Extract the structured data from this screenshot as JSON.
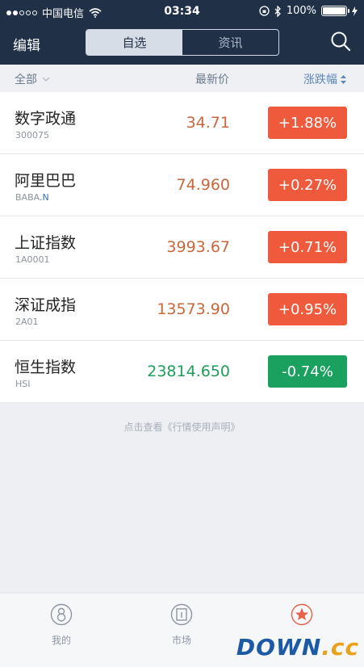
{
  "status": {
    "carrier": "中国电信",
    "time": "03:34",
    "battery": "100%"
  },
  "nav": {
    "edit": "编辑",
    "tabs": [
      {
        "label": "自选",
        "active": true
      },
      {
        "label": "资讯",
        "active": false
      }
    ]
  },
  "header": {
    "all": "全部",
    "price": "最新价",
    "change": "涨跌幅"
  },
  "colors": {
    "up": "#f05a3c",
    "down": "#1aa05f",
    "price_up": "#c8673c",
    "price_down": "#1e9e5a"
  },
  "stocks": [
    {
      "name": "数字政通",
      "code": "300075",
      "tag": "",
      "price": "34.71",
      "change": "+1.88%",
      "direction": "up"
    },
    {
      "name": "阿里巴巴",
      "code": "BABA",
      "tag": ".N",
      "price": "74.960",
      "change": "+0.27%",
      "direction": "up"
    },
    {
      "name": "上证指数",
      "code": "1A0001",
      "tag": "",
      "price": "3993.67",
      "change": "+0.71%",
      "direction": "up"
    },
    {
      "name": "深证成指",
      "code": "2A01",
      "tag": "",
      "price": "13573.90",
      "change": "+0.95%",
      "direction": "up"
    },
    {
      "name": "恒生指数",
      "code": "HSI",
      "tag": "",
      "price": "23814.650",
      "change": "-0.74%",
      "direction": "down"
    }
  ],
  "disclaimer": "点击查看《行情使用声明》",
  "tabbar": [
    {
      "label": "我的",
      "icon": "user-icon"
    },
    {
      "label": "市场",
      "icon": "market-icon"
    },
    {
      "label": "",
      "icon": "star-badge-icon"
    }
  ],
  "watermark": {
    "part1": "DOWN",
    "part2": ".cc"
  }
}
